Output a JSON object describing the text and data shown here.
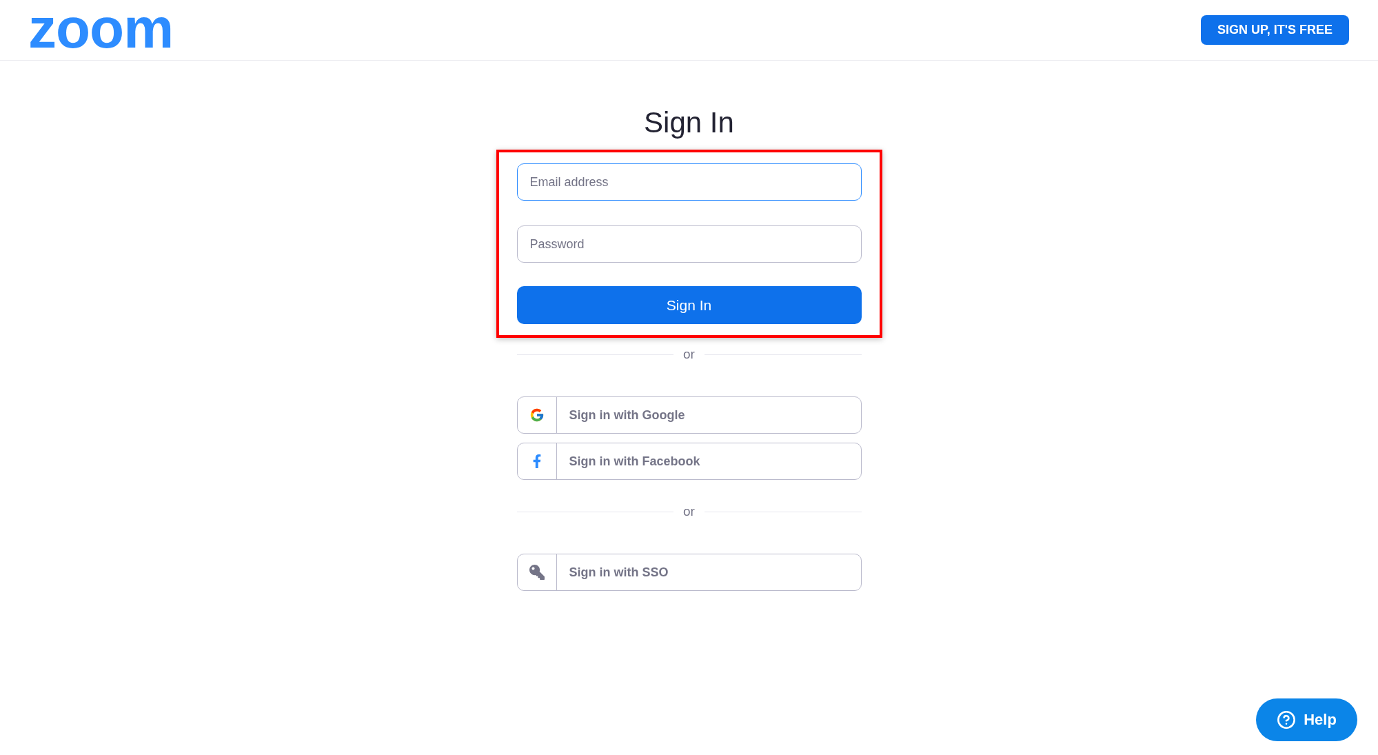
{
  "header": {
    "logo": "zoom",
    "signup_button": "SIGN UP, IT'S FREE"
  },
  "title": "Sign In",
  "form": {
    "highlighted": true,
    "fields": [
      {
        "placeholder": "Email address",
        "focused": true
      },
      {
        "placeholder": "Password",
        "focused": false
      }
    ],
    "submit_button": "Sign In"
  },
  "sections": [
    {
      "divider": "or",
      "buttons": [
        {
          "kind": "google",
          "label": "Sign in with Google"
        },
        {
          "kind": "facebook",
          "label": "Sign in with Facebook"
        }
      ]
    },
    {
      "divider": "or",
      "buttons": [
        {
          "kind": "sso",
          "label": "Sign in with SSO"
        }
      ]
    }
  ],
  "help_button": "Help"
}
